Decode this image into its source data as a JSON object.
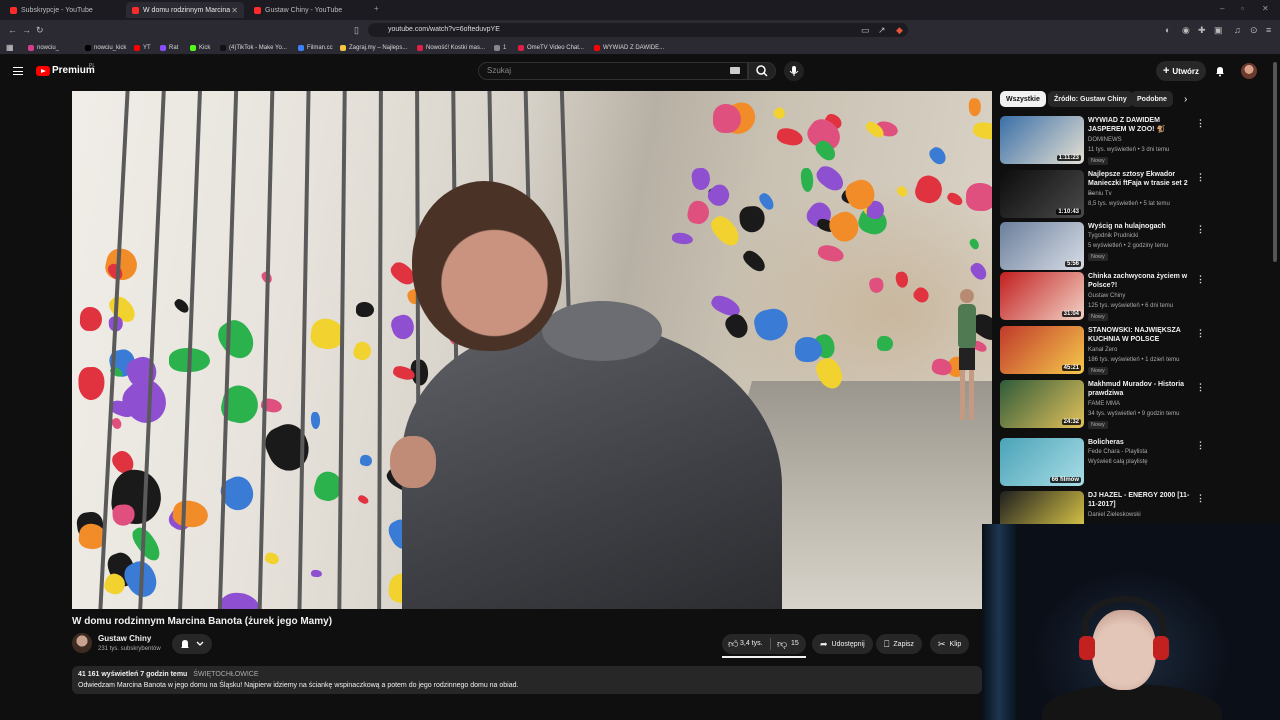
{
  "browser": {
    "tabs": [
      {
        "title": "Subskrypcje - YouTube"
      },
      {
        "title": "W domu rodzinnym Marcina"
      },
      {
        "title": "Gustaw Chiny - YouTube"
      }
    ],
    "url": "youtube.com/watch?v=6ofteduvpYE",
    "bookmarks": [
      {
        "label": "nowciu_",
        "color": "#d43f8d"
      },
      {
        "label": "nowciu_kick",
        "color": "#000000"
      },
      {
        "label": "YT",
        "color": "#ff0000"
      },
      {
        "label": "Rat",
        "color": "#8a4dff"
      },
      {
        "label": "Kick",
        "color": "#53fc18"
      },
      {
        "label": "(4)TikTok - Make Yo...",
        "color": "#111111"
      },
      {
        "label": "Filman.cc",
        "color": "#3b82f6"
      },
      {
        "label": "Zagraj.my – Najleps...",
        "color": "#f5c542"
      },
      {
        "label": "Nowość! Kostki mas...",
        "color": "#e11d48"
      },
      {
        "label": "1",
        "color": "#888888"
      },
      {
        "label": "OmeTV Video Chat...",
        "color": "#e11d48"
      },
      {
        "label": "WYWIAD Z DAWIDE...",
        "color": "#ff0000"
      }
    ]
  },
  "header": {
    "logo": "Premium",
    "region": "PL",
    "search_placeholder": "Szukaj",
    "create_label": "Utwórz"
  },
  "video": {
    "title": "W domu rodzinnym Marcina Banota (żurek jego Mamy)",
    "channel": "Gustaw Chiny",
    "subscribers": "231 tys. subskrybentów",
    "likes": "3,4 tys.",
    "dislikes": "15",
    "share": "Udostępnij",
    "save": "Zapisz",
    "clip": "Klip",
    "views_time": "41 161 wyświetleń  7 godzin temu",
    "location": "ŚWIĘTOCHŁOWICE",
    "description": "Odwiedzam Marcina Banota w jego domu na Śląsku! Najpierw idziemy na ściankę wspinaczkową a potem do jego rodzinnego domu na obiad."
  },
  "chips": [
    "Wszystkie",
    "Źródło: Gustaw Chiny",
    "Podobne"
  ],
  "recommendations": [
    {
      "title": "WYWIAD Z DAWIDEM JASPEREM W ZOO! 🐒",
      "channel": "DOMINEWS",
      "meta": "11 tys. wyświetleń • 3 dni temu",
      "badge": "Nowy",
      "duration": "1:11:23",
      "thumb": [
        "#3a6fa8",
        "#e6e0d2"
      ]
    },
    {
      "title": "Najlepsze sztosy Ekwador Manieczki ftFaja w trasie set 2 ...",
      "channel": "Beniu Tv",
      "meta": "8,5 tys. wyświetleń • 5 lat temu",
      "badge": "",
      "duration": "1:10:43",
      "thumb": [
        "#0c0c0c",
        "#4a4a4a"
      ]
    },
    {
      "title": "Wyścig na hulajnogach",
      "channel": "Tygodnik Prudnicki",
      "meta": "5 wyświetleń • 2 godziny temu",
      "badge": "Nowy",
      "duration": "5:56",
      "thumb": [
        "#6b7f9c",
        "#d8dde6"
      ]
    },
    {
      "title": "Chinka zachwycona życiem w Polsce?!",
      "channel": "Gustaw Chiny",
      "meta": "125 tys. wyświetleń • 6 dni temu",
      "badge": "Nowy",
      "duration": "31:04",
      "thumb": [
        "#c21f1f",
        "#f2d3c6"
      ]
    },
    {
      "title": "STANOWSKI: NAJWIĘKSZA KUCHNIA W POLSCE",
      "channel": "Kanał Zero",
      "meta": "186 tys. wyświetleń • 1 dzień temu",
      "badge": "Nowy",
      "duration": "45:21",
      "thumb": [
        "#c0392b",
        "#f6c94b"
      ]
    },
    {
      "title": "Makhmud Muradov - Historia prawdziwa",
      "channel": "FAME MMA",
      "meta": "34 tys. wyświetleń • 9 godzin temu",
      "badge": "Nowy",
      "duration": "24:32",
      "thumb": [
        "#2f5b3a",
        "#e3c15a"
      ]
    },
    {
      "title": "Bolicheras",
      "channel": "Fede Chara - Playlista",
      "meta": "Wyświetl całą playlistę",
      "badge": "",
      "duration": "66 filmów",
      "thumb": [
        "#4aa3b8",
        "#a9dde6"
      ]
    },
    {
      "title": "DJ HAZEL - ENERGY 2000 [11-11-2017]",
      "channel": "Daniel Zieleskowski",
      "meta": "",
      "badge": "",
      "duration": "",
      "thumb": [
        "#202020",
        "#e8d34a"
      ]
    }
  ],
  "colors": {
    "background": "#0f0f0f",
    "surface": "#272727",
    "brand_red": "#ff0000",
    "text": "#f1f1f1",
    "muted": "#aaaaaa"
  }
}
